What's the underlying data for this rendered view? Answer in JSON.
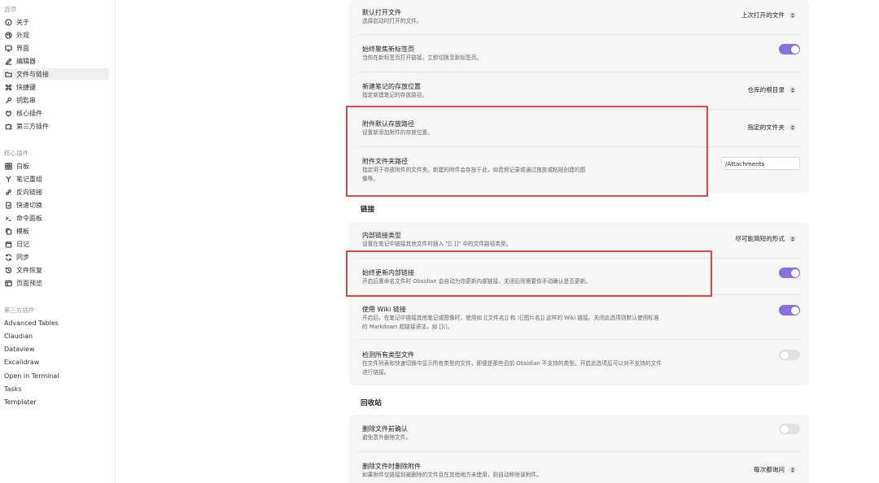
{
  "sidebar": {
    "group_options": "选项",
    "options": [
      {
        "label": "关于",
        "icon": "info-icon"
      },
      {
        "label": "外观",
        "icon": "palette-icon"
      },
      {
        "label": "界面",
        "icon": "monitor-icon"
      },
      {
        "label": "编辑器",
        "icon": "pencil-icon"
      },
      {
        "label": "文件与链接",
        "icon": "folder-icon"
      },
      {
        "label": "快捷键",
        "icon": "command-icon"
      },
      {
        "label": "钥匙串",
        "icon": "key-icon"
      },
      {
        "label": "核心插件",
        "icon": "plug-icon"
      },
      {
        "label": "第三方插件",
        "icon": "puzzle-icon"
      }
    ],
    "group_core": "核心插件",
    "core": [
      {
        "label": "白板",
        "icon": "grid-icon"
      },
      {
        "label": "笔记重组",
        "icon": "merge-icon"
      },
      {
        "label": "反向链接",
        "icon": "link-icon"
      },
      {
        "label": "快速切换",
        "icon": "switch-icon"
      },
      {
        "label": "命令面板",
        "icon": "terminal-icon"
      },
      {
        "label": "模板",
        "icon": "copy-icon"
      },
      {
        "label": "日记",
        "icon": "calendar-icon"
      },
      {
        "label": "同步",
        "icon": "sync-icon"
      },
      {
        "label": "文件恢复",
        "icon": "history-icon"
      },
      {
        "label": "页面预览",
        "icon": "preview-icon"
      }
    ],
    "group_third": "第三方插件",
    "third": [
      "Advanced Tables",
      "Claudian",
      "Dataview",
      "Excalidraw",
      "Open in Terminal",
      "Tasks",
      "Templater"
    ]
  },
  "files": {
    "default_open": {
      "name": "默认打开文件",
      "desc": "选择启动时打开的文件。",
      "value": "上次打开的文件"
    },
    "focus_new_tab": {
      "name": "始终聚焦新标签页",
      "desc": "当你在新标签页打开链接，立即切换至新标签页。",
      "on": true
    },
    "new_note_loc": {
      "name": "新建笔记的存放位置",
      "desc": "指定新建笔记的存放路径。",
      "value": "仓库的根目录"
    },
    "attach_default": {
      "name": "附件默认存放路径",
      "desc": "设置新添加附件的存放位置。",
      "value": "指定的文件夹"
    },
    "attach_folder": {
      "name": "附件文件夹路径",
      "desc": "指定用于存放附件的文件夹。新建的附件会存放于此，如音频记录或通过拖放或粘贴创建的图像等。",
      "value": "/Attachments"
    }
  },
  "links": {
    "title": "链接",
    "internal_type": {
      "name": "内部链接类型",
      "desc": "设置在笔记中链接其他文件时插入 \"[[ ]]\" 中的文件路径类型。",
      "value": "尽可能简短的形式"
    },
    "auto_update": {
      "name": "始终更新内部链接",
      "desc": "开启后重命名文件时 Obsidian 会自动为你更新内部链接，关闭后则需要你手动确认是否更新。",
      "on": true
    },
    "wiki_links": {
      "name": "使用 Wiki 链接",
      "desc": "开启后，在笔记中链接其他笔记或图像时，使用如 [[文件名]] 和 ![[图片名]] 这样的 Wiki 链接。关闭此选项则默认使用标准的 Markdown 超链接语法，如 []()。",
      "on": true
    },
    "detect_all": {
      "name": "检测所有类型文件",
      "desc": "在文件列表和快速切换中显示所有类型的文件，即便是那些目前 Obsidian 不支持的类型。开启此选项后可以对不支持的文件进行链接。",
      "on": false
    }
  },
  "trash": {
    "title": "回收站",
    "confirm_delete": {
      "name": "删除文件前确认",
      "desc": "避免意外删除文件。",
      "on": false
    },
    "delete_attach": {
      "name": "删除文件时删除附件",
      "desc": "如果附件仅链接到被删除的文件且在其他地方未使用，则自动移除该附件。",
      "value": "每次都询问"
    }
  },
  "colors": {
    "accent": "#8a6fe0",
    "highlight": "#e0474c"
  }
}
